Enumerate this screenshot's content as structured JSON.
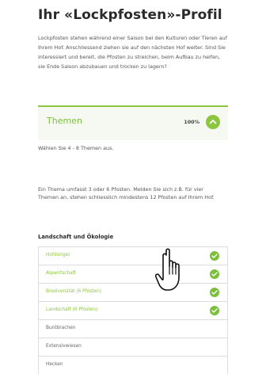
{
  "profile": {
    "title": "Ihr «Lockpfosten»-Profil",
    "intro": "Lockpfosten stehen während einer Saison bei den Kulturen oder Tieren auf Ihrem Hof. Anschliessend ziehen sie auf den nächsten Hof weiter. Sind Sie interessiert und bereit, die Pfosten zu streichen, beim Aufbau zu helfen, sie Ende Saison abzubauen und trocken zu lagern?"
  },
  "section": {
    "title": "Themen",
    "percent": "100%",
    "accent_color": "#8cc63f",
    "toggle_icon": "chevron-up-icon"
  },
  "hint": "Wählen Sie 4 - 8 Themen aus.",
  "info": "Ein Thema umfasst 3 oder 6 Pfosten. Melden Sie sich z.B. für vier Themen an, stehen schliesslich mindestens 12 Pfosten auf Ihrem Hof.",
  "category": {
    "heading": "Landschaft und Ökologie",
    "topics": [
      {
        "label": "Hofdünger",
        "selected": true
      },
      {
        "label": "Alpwirtschaft",
        "selected": true
      },
      {
        "label": "Biodiversität (6 Pfosten)",
        "selected": true
      },
      {
        "label": "Landschaft (6 Pfosten)",
        "selected": true
      },
      {
        "label": "Buntbrachen",
        "selected": false
      },
      {
        "label": "Extensivwiesen",
        "selected": false
      },
      {
        "label": "Hecken",
        "selected": false
      }
    ]
  },
  "cursor_icon": "hand-pointer-icon"
}
